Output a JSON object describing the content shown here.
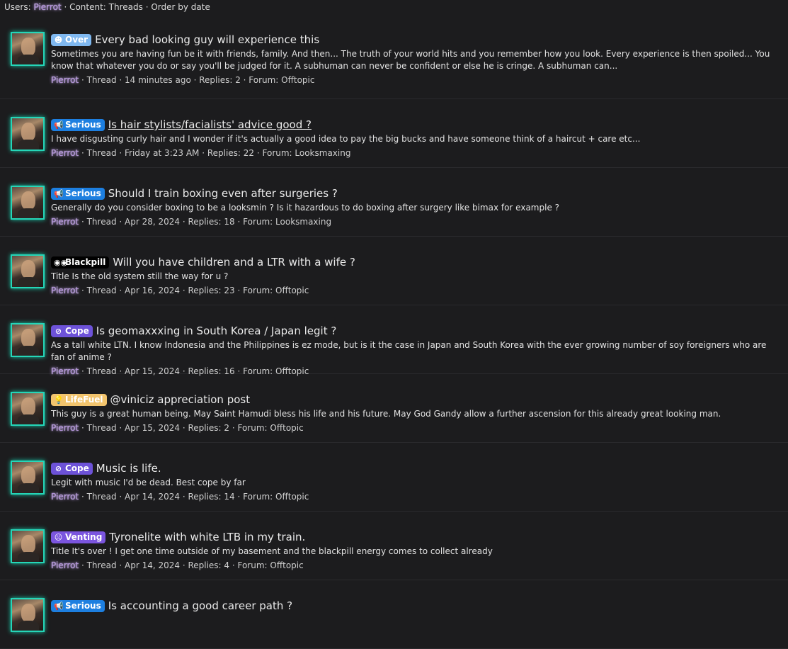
{
  "filters": {
    "users_label": "Users:",
    "user": "Pierrot",
    "rest": "· Content: Threads · Order by date"
  },
  "results": [
    {
      "prefix": {
        "label": "Over",
        "icon": "smile-icon",
        "glyph": "☻",
        "color": "#7fb8f0",
        "text_color": "#ffffff"
      },
      "title": "Every bad looking guy will experience this",
      "underline": false,
      "snippet": "Sometimes you are having fun be it with friends, family. And then... The truth of your world hits and you remember how you look. Every experience is then spoiled... You know that whatever you do or say you'll be judged for it. A subhuman can never be confident or else he is cringe. A subhuman can...",
      "author": "Pierrot",
      "meta": "· Thread · 14 minutes ago · Replies: 2 · Forum: Offtopic"
    },
    {
      "prefix": {
        "label": "Serious",
        "icon": "megaphone-icon",
        "glyph": "📢",
        "color": "#1d7fe0",
        "text_color": "#ffffff"
      },
      "title": "Is hair stylists/facialists' advice good ?",
      "underline": true,
      "snippet": "I have disgusting curly hair and I wonder if it's actually a good idea to pay the big bucks and have someone think of a haircut + care etc...",
      "author": "Pierrot",
      "meta": "· Thread · Friday at 3:23 AM · Replies: 22 · Forum: Looksmaxing"
    },
    {
      "prefix": {
        "label": "Serious",
        "icon": "megaphone-icon",
        "glyph": "📢",
        "color": "#1d7fe0",
        "text_color": "#ffffff"
      },
      "title": "Should I train boxing even after surgeries ?",
      "underline": false,
      "snippet": "Generally do you consider boxing to be a looksmin ? Is it hazardous to do boxing after surgery like bimax for example ?",
      "author": "Pierrot",
      "meta": "· Thread · Apr 28, 2024 · Replies: 18 · Forum: Looksmaxing"
    },
    {
      "prefix": {
        "label": "Blackpill",
        "icon": "glasses-icon",
        "glyph": "◉◉",
        "color": "#000000",
        "text_color": "#ffffff"
      },
      "title": "Will you have children and a LTR with a wife ?",
      "underline": false,
      "snippet": "Title Is the old system still the way for u ?",
      "author": "Pierrot",
      "meta": "· Thread · Apr 16, 2024 · Replies: 23 · Forum: Offtopic"
    },
    {
      "prefix": {
        "label": "Cope",
        "icon": "ban-icon",
        "glyph": "⊘",
        "color": "#6d52d8",
        "text_color": "#ffffff"
      },
      "title": "Is geomaxxxing in South Korea / Japan legit ?",
      "underline": false,
      "snippet": "As a tall white LTN. I know Indonesia and the Philippines is ez mode, but is it the case in Japan and South Korea with the ever growing number of soy foreigners who are fan of anime ?",
      "author": "Pierrot",
      "meta": "· Thread · Apr 15, 2024 · Replies: 16 · Forum: Offtopic"
    },
    {
      "prefix": {
        "label": "LifeFuel",
        "icon": "lightbulb-icon",
        "glyph": "💡",
        "color": "#f2c46d",
        "text_color": "#ffffff"
      },
      "title": "@viniciz appreciation post",
      "underline": false,
      "snippet": "This guy is a great human being. May Saint Hamudi bless his life and his future. May God Gandy allow a further ascension for this already great looking man.",
      "author": "Pierrot",
      "meta": "· Thread · Apr 15, 2024 · Replies: 2 · Forum: Offtopic"
    },
    {
      "prefix": {
        "label": "Cope",
        "icon": "ban-icon",
        "glyph": "⊘",
        "color": "#6d52d8",
        "text_color": "#ffffff"
      },
      "title": "Music is life.",
      "underline": false,
      "snippet": "Legit with music I'd be dead. Best cope by far",
      "author": "Pierrot",
      "meta": "· Thread · Apr 14, 2024 · Replies: 14 · Forum: Offtopic"
    },
    {
      "prefix": {
        "label": "Venting",
        "icon": "angry-face-icon",
        "glyph": "☹",
        "color": "#7b55df",
        "text_color": "#ffffff"
      },
      "title": "Tyronelite with white LTB in my train.",
      "underline": false,
      "snippet": "Title It's over ! I get one time outside of my basement and the blackpill energy comes to collect already",
      "author": "Pierrot",
      "meta": "· Thread · Apr 14, 2024 · Replies: 4 · Forum: Offtopic"
    },
    {
      "prefix": {
        "label": "Serious",
        "icon": "megaphone-icon",
        "glyph": "📢",
        "color": "#1d7fe0",
        "text_color": "#ffffff"
      },
      "title": "Is accounting a good career path ?",
      "underline": false,
      "snippet": "",
      "author": "",
      "meta": ""
    }
  ]
}
